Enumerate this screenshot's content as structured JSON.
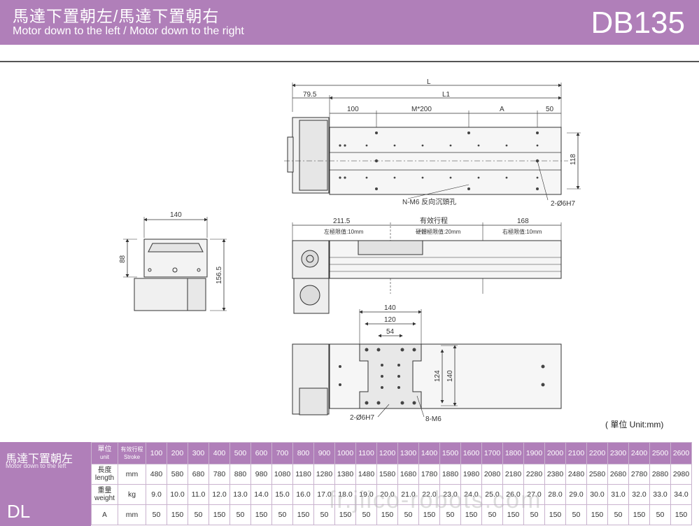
{
  "header": {
    "title_zh": "馬達下置朝左/馬達下置朝右",
    "title_en": "Motor down to the left / Motor down to the right",
    "model": "DB135"
  },
  "top_view": {
    "dim_L": "L",
    "dim_L1": "L1",
    "dim_79_5": "79.5",
    "dim_100": "100",
    "dim_M200": "M*200",
    "dim_A": "A",
    "dim_50": "50",
    "dim_118": "118",
    "label_m6": "N-M6 反向沉頭孔",
    "label_pin": "2-Ø6H7"
  },
  "end_view": {
    "dim_140": "140",
    "dim_88": "88",
    "dim_156_5": "156.5"
  },
  "side_view": {
    "dim_211_5": "211.5",
    "label_stroke": "有效行程",
    "dim_168": "168",
    "note_left": "左極限值:10mm",
    "note_mid": "硬體極限值:20mm",
    "note_right": "右極限值:10mm"
  },
  "carriage_view": {
    "dim_140": "140",
    "dim_120": "120",
    "dim_54": "54",
    "dim_124": "124",
    "dim_140v": "140",
    "label_pin": "2-Ø6H7",
    "label_m6": "8-M6"
  },
  "unit_note": "( 單位 Unit:mm)",
  "spec": {
    "title_zh": "馬達下置朝左",
    "title_en": "Motor down to the left",
    "code": "DL",
    "header_unit_zh": "單位",
    "header_unit_en": "unit",
    "header_stroke_zh": "有效行程",
    "header_stroke_en": "Stroke",
    "strokes": [
      "100",
      "200",
      "300",
      "400",
      "500",
      "600",
      "700",
      "800",
      "900",
      "1000",
      "1100",
      "1200",
      "1300",
      "1400",
      "1500",
      "1600",
      "1700",
      "1800",
      "1900",
      "2000",
      "2100",
      "2200",
      "2300",
      "2400",
      "2500",
      "2600"
    ],
    "rows": [
      {
        "label_zh": "長度",
        "label_en": "length",
        "unit": "mm",
        "values": [
          "480",
          "580",
          "680",
          "780",
          "880",
          "980",
          "1080",
          "1180",
          "1280",
          "1380",
          "1480",
          "1580",
          "1680",
          "1780",
          "1880",
          "1980",
          "2080",
          "2180",
          "2280",
          "2380",
          "2480",
          "2580",
          "2680",
          "2780",
          "2880",
          "2980"
        ]
      },
      {
        "label_zh": "重量",
        "label_en": "weight",
        "unit": "kg",
        "values": [
          "9.0",
          "10.0",
          "11.0",
          "12.0",
          "13.0",
          "14.0",
          "15.0",
          "16.0",
          "17.0",
          "18.0",
          "19.0",
          "20.0",
          "21.0",
          "22.0",
          "23.0",
          "24.0",
          "25.0",
          "26.0",
          "27.0",
          "28.0",
          "29.0",
          "30.0",
          "31.0",
          "32.0",
          "33.0",
          "34.0"
        ]
      },
      {
        "label_zh": "",
        "label_en": "A",
        "unit": "mm",
        "values": [
          "50",
          "150",
          "50",
          "150",
          "50",
          "150",
          "50",
          "150",
          "50",
          "150",
          "50",
          "150",
          "50",
          "150",
          "50",
          "150",
          "50",
          "150",
          "50",
          "150",
          "50",
          "150",
          "50",
          "150",
          "50",
          "150"
        ]
      }
    ]
  },
  "watermark": "fr.jiico-robots.com",
  "colors": {
    "accent": "#b07fb9",
    "border": "#c9b3ce"
  }
}
